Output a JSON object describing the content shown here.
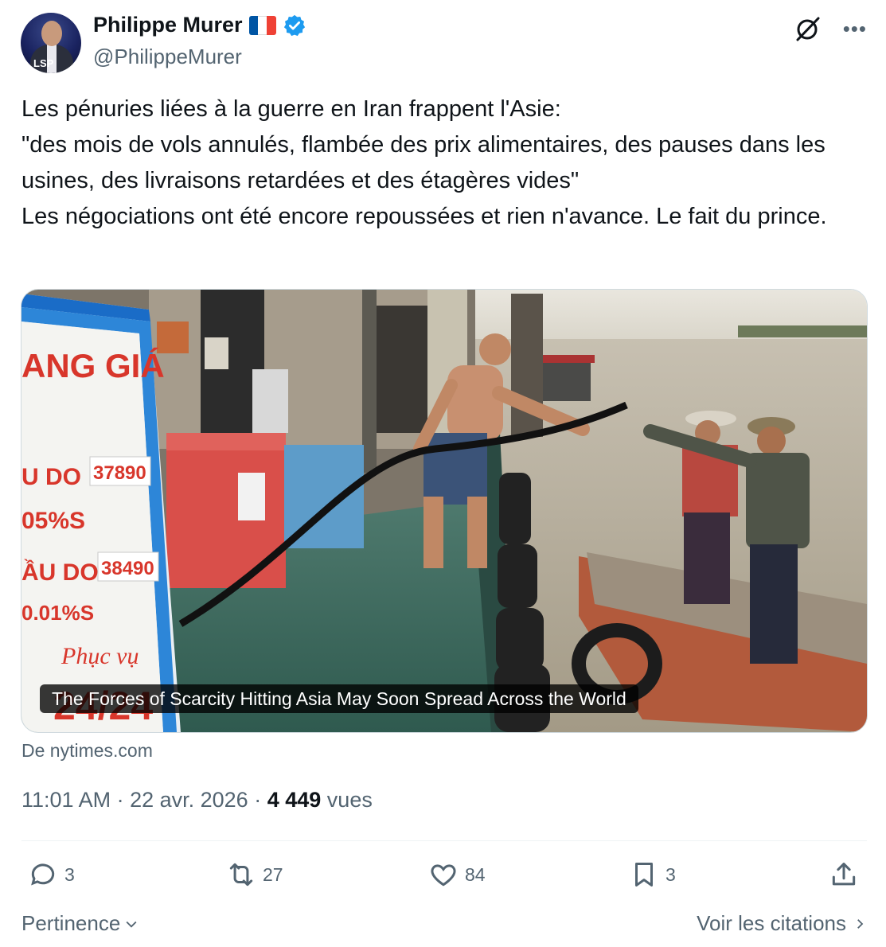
{
  "author": {
    "name": "Philippe Murer",
    "handle": "@PhilippeMurer",
    "flag_colors": [
      "#0055A4",
      "#FFFFFF",
      "#EF4135"
    ],
    "verified_color": "#1D9BF0"
  },
  "tweet": {
    "text": "Les pénuries liées à la guerre en Iran frappent l'Asie:\n\"des mois de vols annulés, flambée des prix alimentaires, des pauses dans les usines, des livraisons retardées et des étagères vides\"\nLes négociations ont été encore repoussées et rien n'avance. Le fait du prince."
  },
  "card": {
    "caption": "The Forces of Scarcity Hitting Asia May Soon Spread Across the World",
    "source": "De nytimes.com",
    "sign": {
      "header": "ANG GIÁ",
      "line1": "U DO",
      "line1b": "05%S",
      "price1": "37890",
      "line2": "ẦU DO",
      "line2b": "0.01%S",
      "price2": "38490",
      "footer": "Phục vụ",
      "footer2": "24/24"
    }
  },
  "meta": {
    "time": "11:01 AM",
    "date": "22 avr. 2026",
    "views": "4 449",
    "views_label": "vues"
  },
  "actions": {
    "replies": "3",
    "reposts": "27",
    "likes": "84",
    "bookmarks": "3"
  },
  "footer": {
    "sort_label": "Pertinence",
    "quotes_label": "Voir les citations"
  },
  "icons": [
    "grok-icon",
    "more-icon",
    "reply-icon",
    "repost-icon",
    "like-icon",
    "bookmark-icon",
    "share-icon",
    "chevron-down-icon",
    "chevron-right-icon",
    "verified-icon"
  ]
}
